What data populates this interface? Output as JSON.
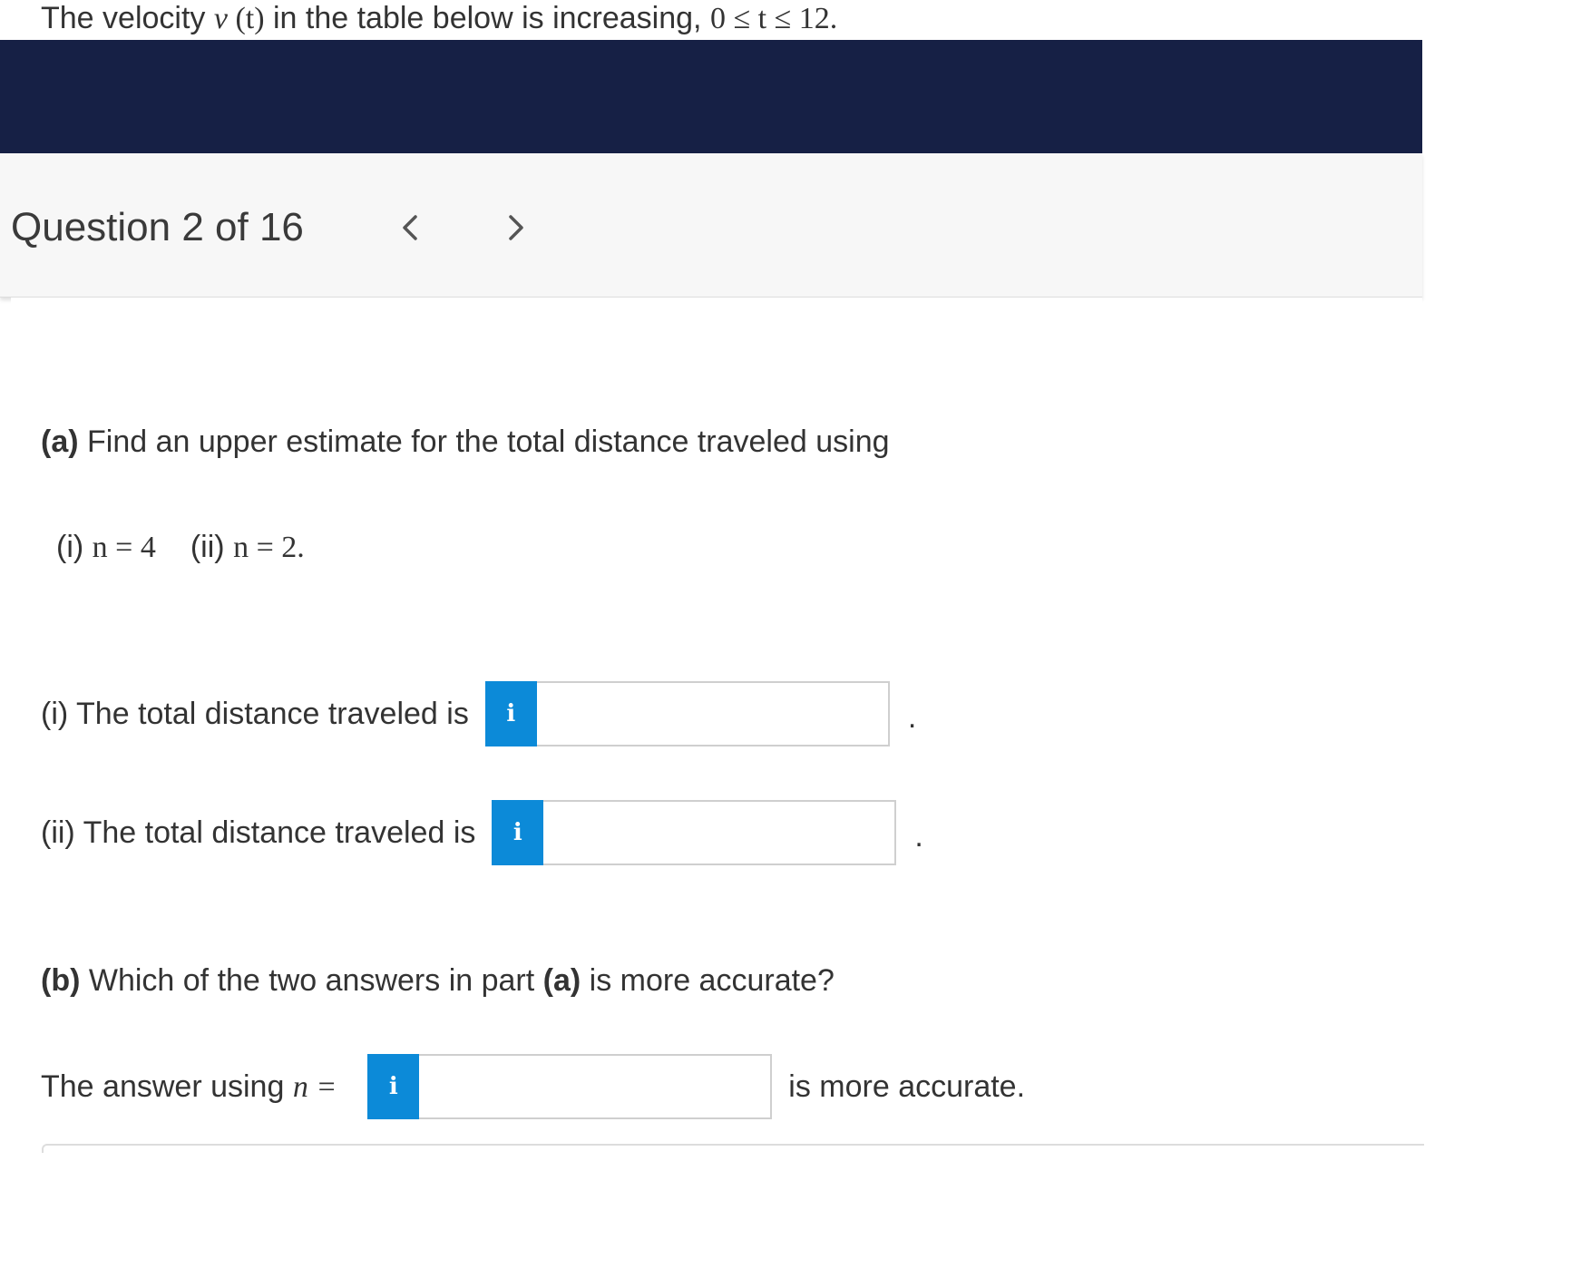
{
  "prompt": {
    "text_before": "The velocity ",
    "math_v": "v",
    "math_t": "(t)",
    "text_after": " in the table below is increasing, ",
    "math_range": "0 ≤ t ≤ 12."
  },
  "question_nav": {
    "title": "Question 2 of 16",
    "prev_icon": "chevron-left-icon",
    "next_icon": "chevron-right-icon"
  },
  "part_a": {
    "label": "(a)",
    "text": " Find an upper estimate for the total distance traveled using",
    "n_values": {
      "i_label": "(i)",
      "i_expr": "n = 4",
      "ii_label": "(ii)",
      "ii_expr": "n = 2."
    },
    "answer_i": {
      "label": "(i) The total distance traveled is",
      "info": "i",
      "value": "",
      "suffix": "."
    },
    "answer_ii": {
      "label": "(ii) The total distance traveled is",
      "info": "i",
      "value": "",
      "suffix": "."
    }
  },
  "part_b": {
    "label": "(b)",
    "text_before": " Which of the two answers in part ",
    "label_a": "(a)",
    "text_after": " is more accurate?",
    "answer": {
      "label": "The answer using",
      "math": "n =",
      "info": "i",
      "value": "",
      "suffix": "is more accurate."
    }
  },
  "colors": {
    "header_band": "#162045",
    "info_button": "#0c8ad8",
    "nav_bg": "#f7f7f7"
  }
}
